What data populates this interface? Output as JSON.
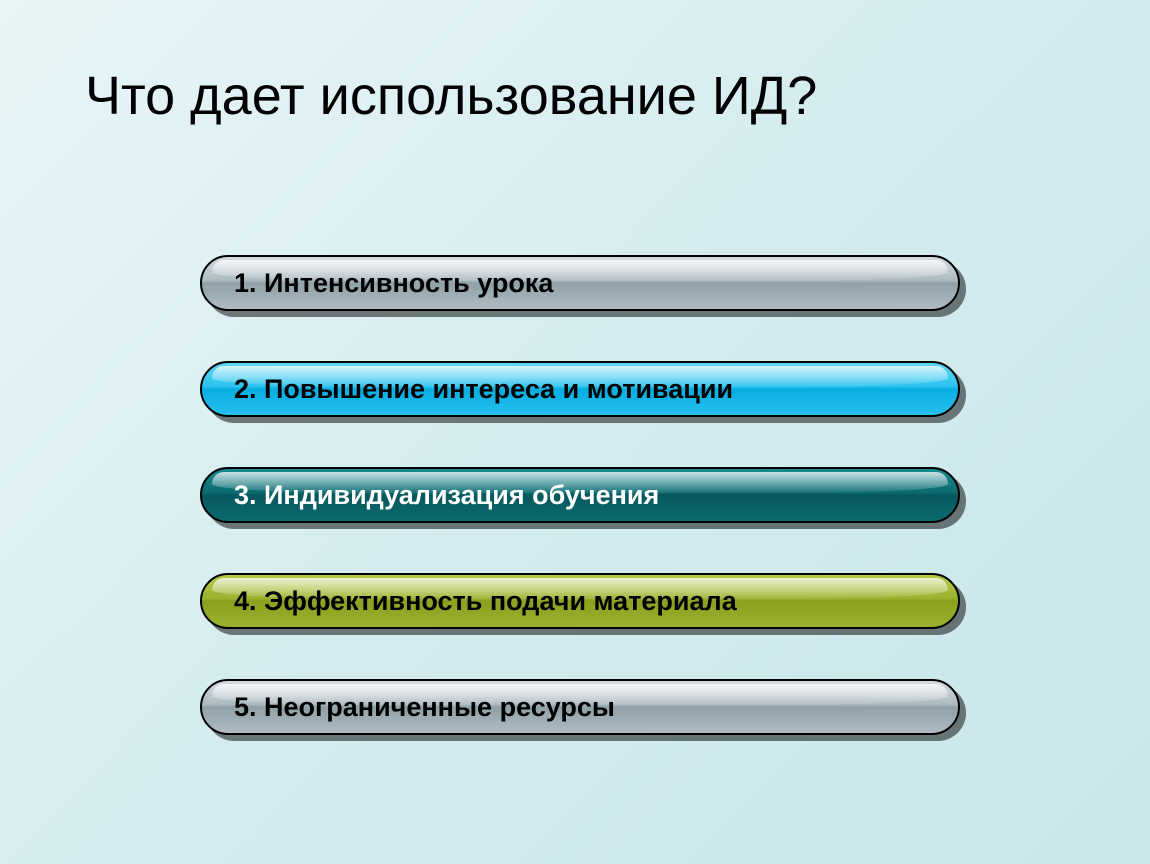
{
  "title": "Что дает использование ИД?",
  "items": [
    {
      "text": "1. Интенсивность урока",
      "color": "gray"
    },
    {
      "text": "2. Повышение интереса и мотивации",
      "color": "cyan"
    },
    {
      "text": "3. Индивидуализация обучения",
      "color": "teal"
    },
    {
      "text": "4. Эффективность подачи материала",
      "color": "olive"
    },
    {
      "text": "5. Неограниченные ресурсы",
      "color": "gray"
    }
  ]
}
